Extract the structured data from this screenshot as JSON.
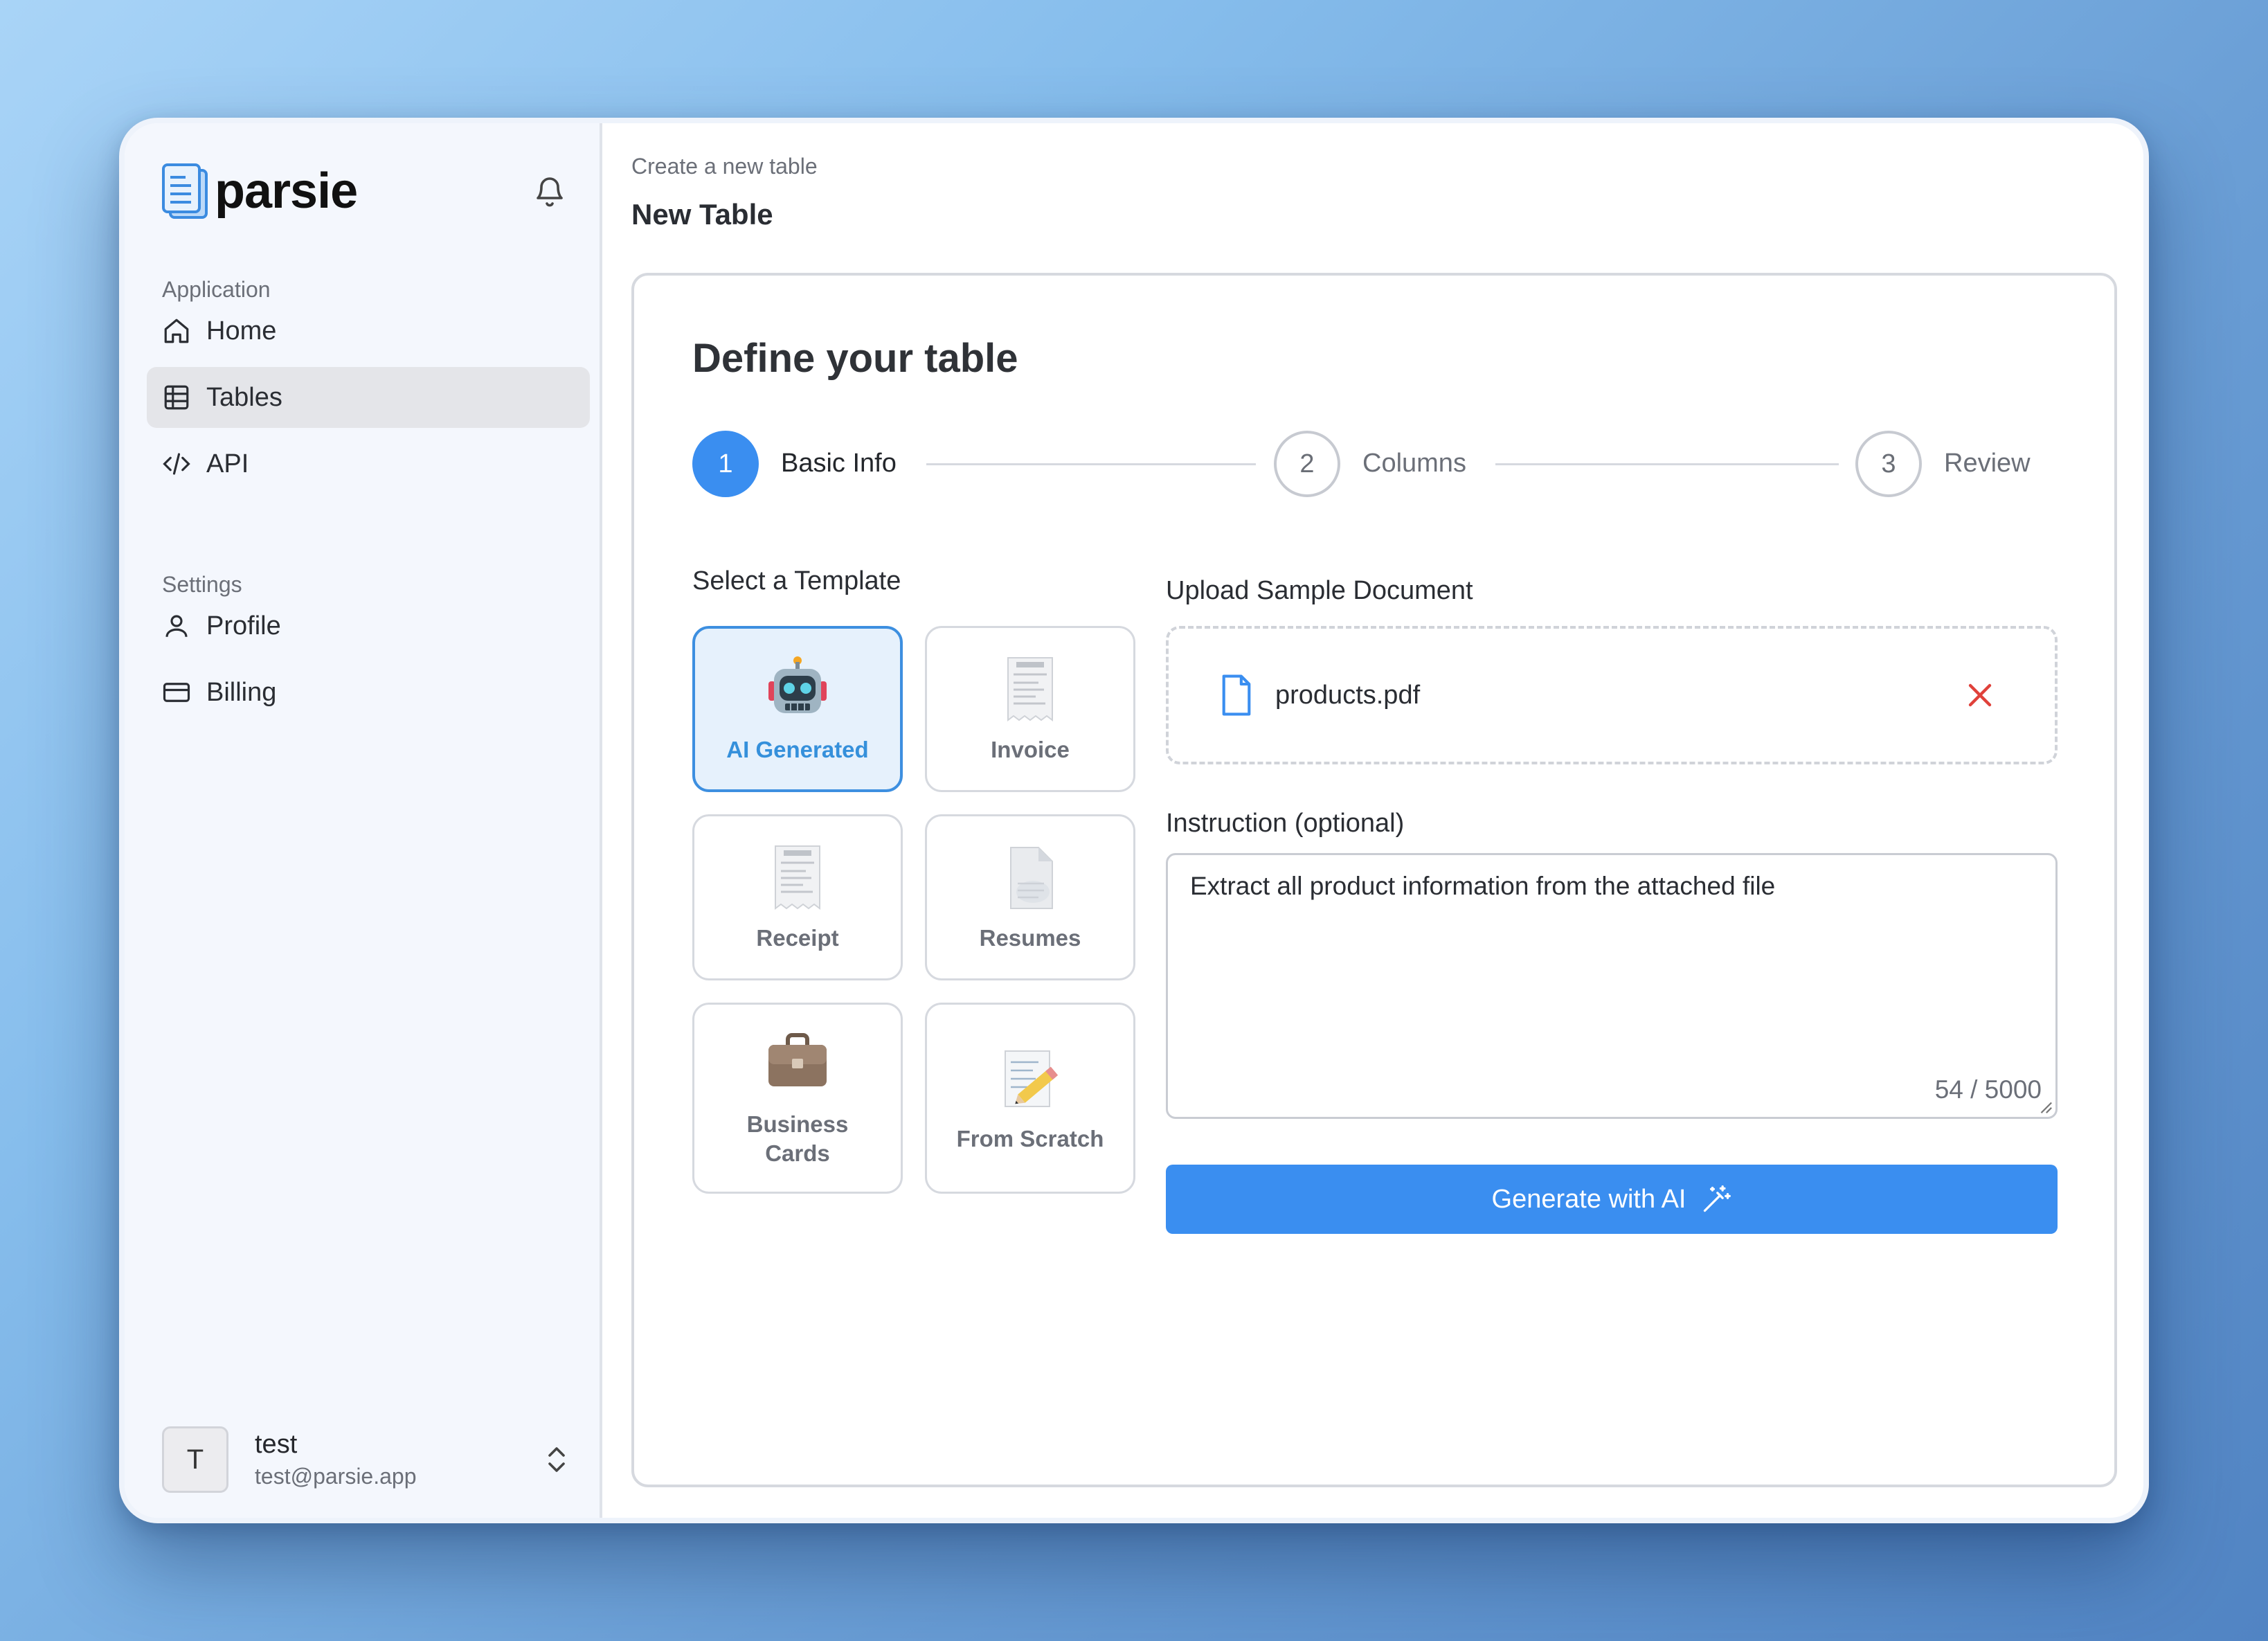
{
  "app": {
    "name": "parsie"
  },
  "sidebar": {
    "application_label": "Application",
    "settings_label": "Settings",
    "items": [
      {
        "label": "Home",
        "icon": "home-icon"
      },
      {
        "label": "Tables",
        "icon": "table-icon",
        "active": true
      },
      {
        "label": "API",
        "icon": "code-icon"
      },
      {
        "label": "Profile",
        "icon": "user-icon"
      },
      {
        "label": "Billing",
        "icon": "credit-card-icon"
      }
    ],
    "user": {
      "initial": "T",
      "name": "test",
      "email": "test@parsie.app"
    }
  },
  "main": {
    "breadcrumb": "Create a new table",
    "title": "New Table",
    "card_title": "Define your table",
    "steps": [
      {
        "number": "1",
        "label": "Basic Info",
        "active": true
      },
      {
        "number": "2",
        "label": "Columns"
      },
      {
        "number": "3",
        "label": "Review"
      }
    ],
    "template_label": "Select a Template",
    "templates": [
      {
        "label": "AI Generated",
        "icon": "robot-icon",
        "selected": true
      },
      {
        "label": "Invoice",
        "icon": "receipt-icon"
      },
      {
        "label": "Receipt",
        "icon": "receipt-icon"
      },
      {
        "label": "Resumes",
        "icon": "document-icon"
      },
      {
        "label": "Business Cards",
        "icon": "briefcase-icon"
      },
      {
        "label": "From Scratch",
        "icon": "pencil-paper-icon"
      }
    ],
    "upload_label": "Upload Sample Document",
    "file_name": "products.pdf",
    "instruction_label": "Instruction (optional)",
    "instruction_text": "Extract all product information from the attached file",
    "char_count": "54 / 5000",
    "generate_label": "Generate with AI"
  },
  "colors": {
    "accent": "#3a8ef0",
    "remove": "#e0413a",
    "selected_bg": "#e6f1fc"
  }
}
